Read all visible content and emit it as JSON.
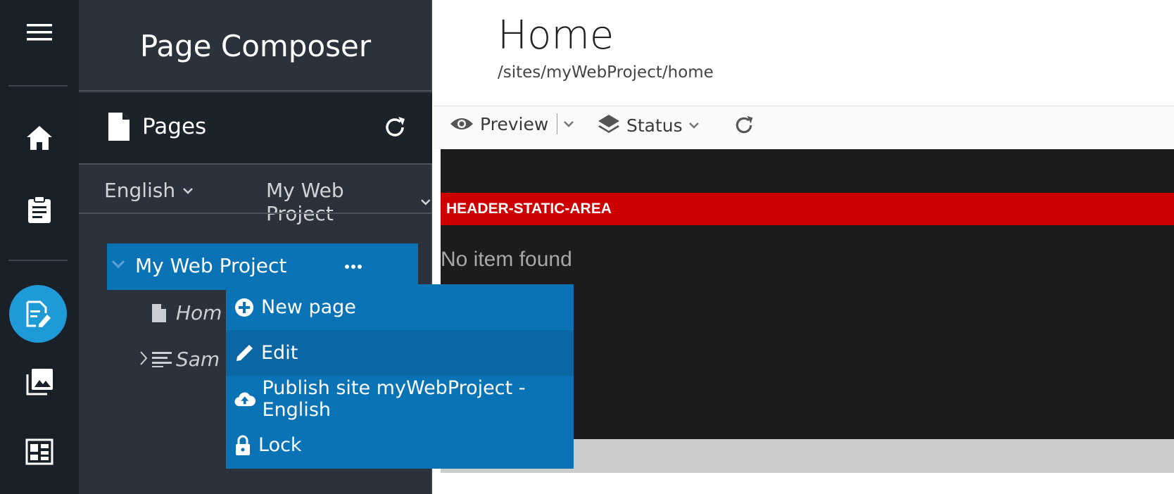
{
  "panel": {
    "title": "Page Composer",
    "pages_label": "Pages",
    "language": "English",
    "site": "My Web Project"
  },
  "tree": {
    "root": "My Web Project",
    "items": [
      {
        "label": "Hom",
        "icon": "page-icon"
      },
      {
        "label": "Sam",
        "icon": "list-icon"
      }
    ]
  },
  "context_menu": {
    "items": [
      {
        "label": "New page",
        "icon": "plus-circle-icon"
      },
      {
        "label": "Edit",
        "icon": "pencil-icon"
      },
      {
        "label": "Publish site myWebProject - English",
        "icon": "cloud-upload-icon"
      },
      {
        "label": "Lock",
        "icon": "lock-icon"
      }
    ]
  },
  "page": {
    "title": "Home",
    "path": "/sites/myWebProject/home"
  },
  "toolbar": {
    "preview": "Preview",
    "status": "Status"
  },
  "preview_area": {
    "header_static": "HEADER-STATIC-AREA",
    "empty_text": "No item found"
  },
  "colors": {
    "accent": "#0a73b5",
    "active_nav": "#1e9ad6",
    "header_red": "#cc0000",
    "panel_bg": "#2b323b",
    "iconbar_bg": "#1a2027"
  }
}
